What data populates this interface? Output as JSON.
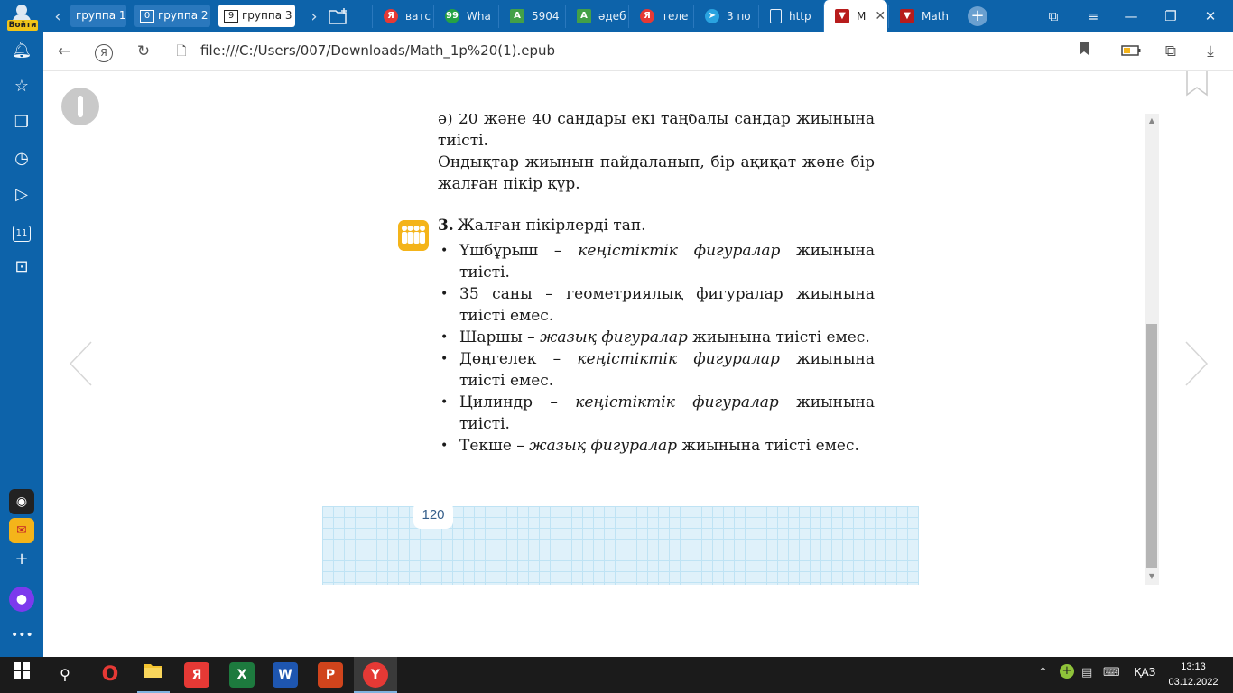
{
  "tabbar": {
    "account_badge": "Войти",
    "groups": [
      {
        "count": "",
        "label": "группа 1"
      },
      {
        "count": "0",
        "label": "группа 2"
      },
      {
        "count": "9",
        "label": "группа 3"
      }
    ],
    "tabs": [
      {
        "label": "ватс",
        "icon": "yandex-icon",
        "color": "#e53935"
      },
      {
        "label": "Wha",
        "icon": "whatsapp-icon",
        "color": "#25a244"
      },
      {
        "label": "5904",
        "icon": "tutor-a-icon",
        "color": "#43a047"
      },
      {
        "label": "әдеб",
        "icon": "tutor-a-icon",
        "color": "#43a047"
      },
      {
        "label": "теле",
        "icon": "yandex-icon",
        "color": "#e53935"
      },
      {
        "label": "3 по",
        "icon": "telegram-icon",
        "color": "#2aa3e0"
      },
      {
        "label": "http",
        "icon": "page-icon",
        "color": "#ffffff"
      },
      {
        "label": "M",
        "icon": "pdf-shield-icon",
        "color": "#b71c1c"
      },
      {
        "label": "Math",
        "icon": "pdf-shield-icon",
        "color": "#b71c1c"
      }
    ]
  },
  "toolbar": {
    "url": "file:///C:/Users/007/Downloads/Math_1p%20(1).epub"
  },
  "sidebar": {
    "counter_badge": "11"
  },
  "book": {
    "para_a": "ә) 20 және 40 сандары екі таңбалы сандар жиынына тиісті.",
    "para_task": "Ондықтар жиынын пайдаланып, бір ақиқат және бір жалған пікір құр.",
    "task3": {
      "number": "3.",
      "title": "Жалған пікірлерді тап.",
      "statements": [
        {
          "pre": "Үшбұрыш – ",
          "em": "кеңістіктік фигуралар",
          "post": " жиынына тиісті."
        },
        {
          "pre": "35 саны – геометриялық фигуралар жиынына тиісті емес.",
          "em": "",
          "post": ""
        },
        {
          "pre": "Шаршы – ",
          "em": "жазық фигуралар",
          "post": " жиынына тиісті емес."
        },
        {
          "pre": "Дөңгелек – ",
          "em": "кеңістіктік фигуралар",
          "post": " жиынына тиісті емес."
        },
        {
          "pre": "Цилиндр – ",
          "em": "кеңістіктік фигуралар",
          "post": " жиынына тиісті."
        },
        {
          "pre": "Текше – ",
          "em": "жазық фигуралар",
          "post": " жиынына тиісті емес."
        }
      ]
    },
    "page_number": "120"
  },
  "taskbar": {
    "lang": "ҚАЗ",
    "time": "13:13",
    "date": "03.12.2022"
  },
  "colors": {
    "browser_blue": "#0d63aa",
    "footer_grid": "#dff1fa",
    "group_icon": "#f4b41a"
  }
}
